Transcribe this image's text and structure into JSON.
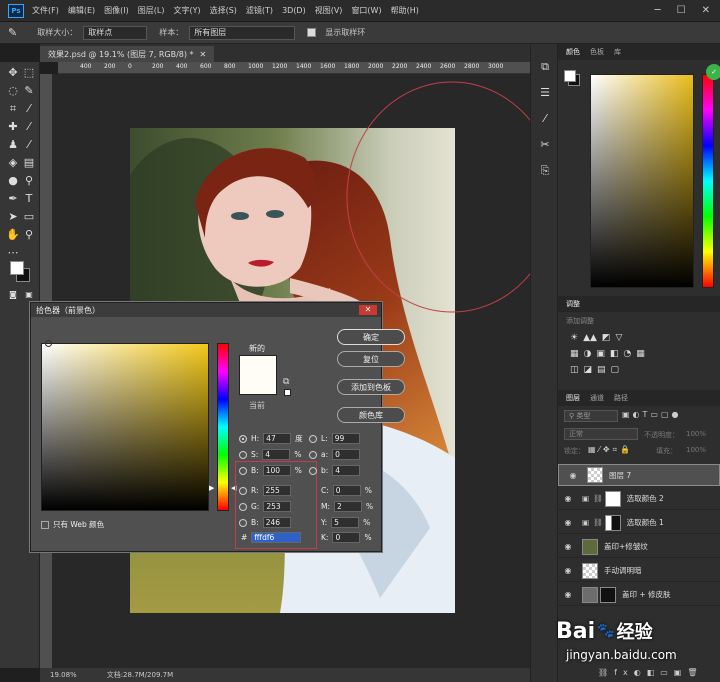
{
  "menu": {
    "logo": "Ps",
    "items": [
      "文件(F)",
      "编辑(E)",
      "图像(I)",
      "图层(L)",
      "文字(Y)",
      "选择(S)",
      "滤镜(T)",
      "3D(D)",
      "视图(V)",
      "窗口(W)",
      "帮助(H)"
    ],
    "window_controls": [
      "─",
      "☐",
      "✕"
    ]
  },
  "options": {
    "sample_size_label": "取样大小：",
    "sample_size_value": "取样点",
    "sample_label": "样本：",
    "sample_value": "所有图层",
    "show_ring_label": "显示取样环"
  },
  "document": {
    "tab_title": "效果2.psd @ 19.1% (图层 7, RGB/8) *",
    "ruler_ticks": [
      "400",
      "200",
      "0",
      "200",
      "400",
      "600",
      "800",
      "1000",
      "1200",
      "1400",
      "1600",
      "1800",
      "2000",
      "2200",
      "2400",
      "2600",
      "2800",
      "3000"
    ]
  },
  "status": {
    "zoom": "19.08%",
    "doc_size": "文档:28.7M/209.7M"
  },
  "color_panel": {
    "tabs": [
      "颜色",
      "色板",
      "库"
    ],
    "gradient_top": "#e9bd1a"
  },
  "adjustments_panel": {
    "tab": "调整",
    "add_label": "添加调整",
    "rows": [
      [
        "☀",
        "▲▲",
        "◩",
        "▽"
      ],
      [
        "▦",
        "◑",
        "▣",
        "◧",
        "◔",
        "▦"
      ],
      [
        "◫",
        "◪",
        "▤",
        "▢"
      ]
    ]
  },
  "layers_panel": {
    "tabs": [
      "图层",
      "通道",
      "路径"
    ],
    "filter_label": "类型",
    "blend_mode": "正常",
    "opacity_label": "不透明度：",
    "opacity_value": "100%",
    "lock_label": "锁定：",
    "fill_label": "填充：",
    "fill_value": "100%",
    "layers": [
      {
        "name": "图层 7",
        "selected": true
      },
      {
        "name": "选取颜色 2",
        "selected": false
      },
      {
        "name": "选取颜色 1",
        "selected": false
      },
      {
        "name": "盖印+修皱纹",
        "selected": false
      },
      {
        "name": "手动调明暗",
        "selected": false
      },
      {
        "name": "盖印 + 修皮肤",
        "selected": false
      }
    ]
  },
  "picker": {
    "title": "拾色器（前景色）",
    "close": "✕",
    "new_label": "新的",
    "current_label": "当前",
    "buttons": {
      "ok": "确定",
      "reset": "复位",
      "add_swatch": "添加到色板",
      "libraries": "颜色库"
    },
    "web_only_label": "只有 Web 颜色",
    "fields": {
      "H": {
        "label": "H:",
        "value": "47",
        "unit": "度"
      },
      "S": {
        "label": "S:",
        "value": "4",
        "unit": "%"
      },
      "B": {
        "label": "B:",
        "value": "100",
        "unit": "%"
      },
      "R": {
        "label": "R:",
        "value": "255"
      },
      "G": {
        "label": "G:",
        "value": "253"
      },
      "Bl": {
        "label": "B:",
        "value": "246"
      },
      "L": {
        "label": "L:",
        "value": "99"
      },
      "a": {
        "label": "a:",
        "value": "0"
      },
      "b": {
        "label": "b:",
        "value": "4"
      },
      "C": {
        "label": "C:",
        "value": "0",
        "unit": "%"
      },
      "M": {
        "label": "M:",
        "value": "2",
        "unit": "%"
      },
      "Y": {
        "label": "Y:",
        "value": "5",
        "unit": "%"
      },
      "K": {
        "label": "K:",
        "value": "0",
        "unit": "%"
      },
      "hex": {
        "label": "#",
        "value": "fffdf6"
      }
    },
    "swatch_new": "#fffdf6",
    "swatch_current": "#fffdf6",
    "hue": "#f2c81a"
  },
  "watermark": {
    "brand": "Bai",
    "brand2": "经验",
    "url": "jingyan.baidu.com"
  },
  "colors": {
    "accent": "#31a8ff",
    "close_red": "#c83a2f",
    "sample_ring": "#c0404a"
  }
}
